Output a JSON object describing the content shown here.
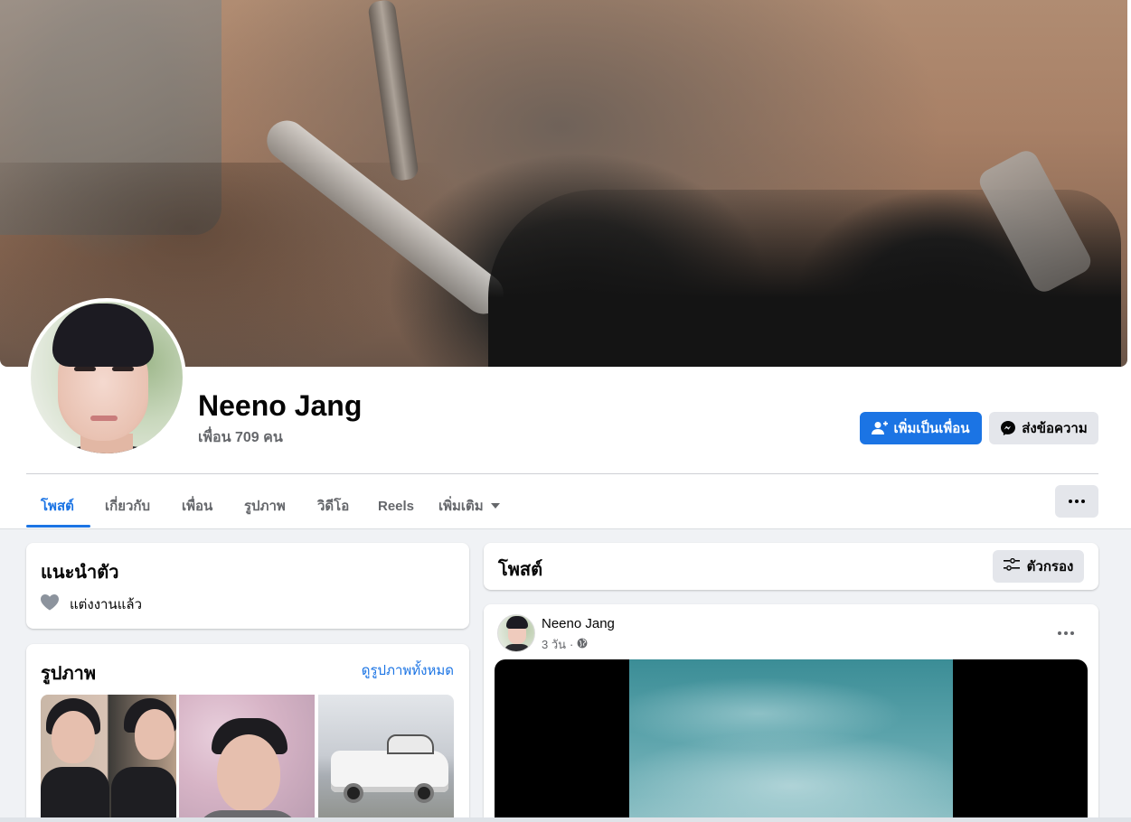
{
  "profile": {
    "name": "Neeno Jang",
    "friends_text": "เพื่อน 709 คน"
  },
  "actions": {
    "add_friend_label": "เพิ่มเป็นเพื่อน",
    "message_label": "ส่งข้อความ"
  },
  "tabs": [
    {
      "label": "โพสต์",
      "active": true
    },
    {
      "label": "เกี่ยวกับ"
    },
    {
      "label": "เพื่อน"
    },
    {
      "label": "รูปภาพ"
    },
    {
      "label": "วิดีโอ"
    },
    {
      "label": "Reels"
    },
    {
      "label": "เพิ่มเติม"
    }
  ],
  "intro": {
    "title": "แนะนำตัว",
    "relationship": "แต่งงานแล้ว"
  },
  "photos": {
    "title": "รูปภาพ",
    "see_all": "ดูรูปภาพทั้งหมด"
  },
  "posts": {
    "title": "โพสต์",
    "filter_label": "ตัวกรอง"
  },
  "post": {
    "author": "Neeno Jang",
    "time": "3 วัน",
    "separator": "·"
  },
  "colors": {
    "accent": "#1b74e4",
    "page_bg": "#f0f2f5",
    "secondary_button": "#e4e6eb",
    "muted_text": "#65676b"
  },
  "icons": {
    "add_friend": "person-plus-icon",
    "message": "messenger-icon",
    "more": "ellipsis-icon",
    "relationship": "heart-icon",
    "filter": "sliders-icon",
    "privacy": "globe-icon"
  }
}
